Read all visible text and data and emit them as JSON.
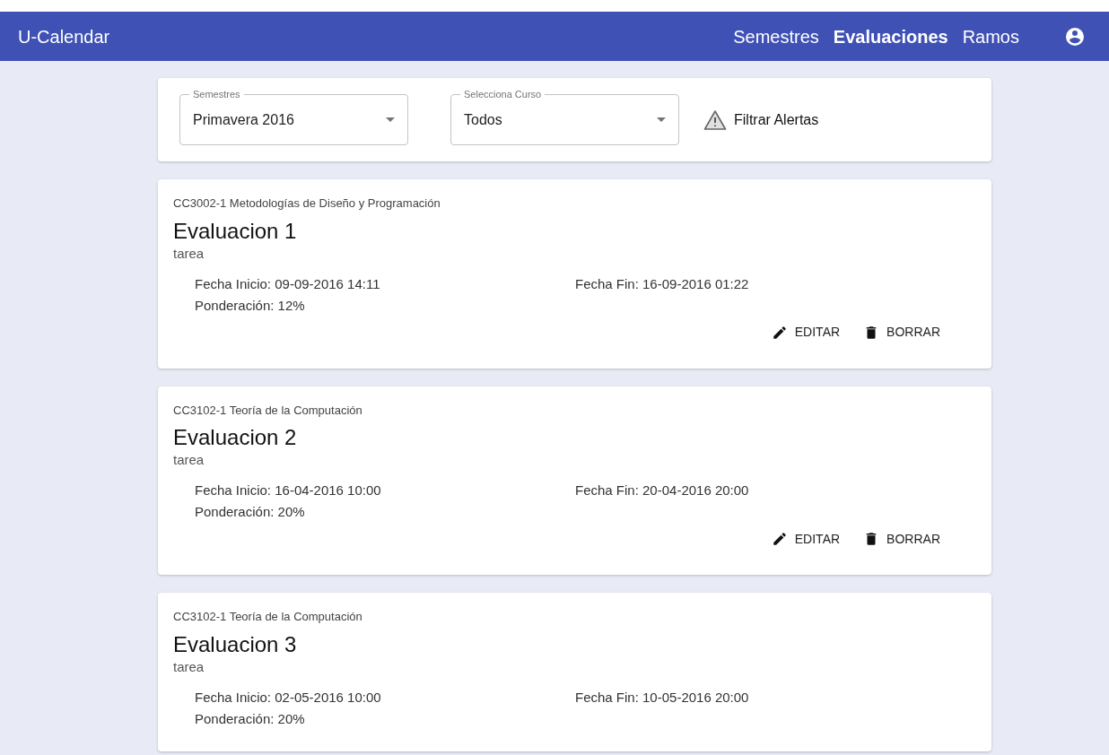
{
  "app_bar": {
    "title": "U-Calendar",
    "nav": [
      {
        "label": "Semestres",
        "selected": false
      },
      {
        "label": "Evaluaciones",
        "selected": true
      },
      {
        "label": "Ramos",
        "selected": false
      }
    ]
  },
  "filters": {
    "semester": {
      "label": "Semestres",
      "value": "Primavera 2016"
    },
    "course": {
      "label": "Selecciona Curso",
      "value": "Todos"
    },
    "alerts_button": "Filtrar Alertas"
  },
  "evaluations": [
    {
      "course": "CC3002-1 Metodologías de Diseño y Programación",
      "title": "Evaluacion 1",
      "type": "tarea",
      "start": "Fecha Inicio: 09-09-2016 14:11",
      "end": "Fecha Fin: 16-09-2016 01:22",
      "weight": "Ponderación: 12%",
      "actions": [
        "EDITAR",
        "BORRAR"
      ]
    },
    {
      "course": "CC3102-1 Teoría de la Computación",
      "title": "Evaluacion 2",
      "type": "tarea",
      "start": "Fecha Inicio: 16-04-2016 10:00",
      "end": "Fecha Fin: 20-04-2016 20:00",
      "weight": "Ponderación: 20%",
      "actions": [
        "EDITAR",
        "BORRAR"
      ]
    },
    {
      "course": "CC3102-1 Teoría de la Computación",
      "title": "Evaluacion 3",
      "type": "tarea",
      "start": "Fecha Inicio: 02-05-2016 10:00",
      "end": "Fecha Fin: 10-05-2016 20:00",
      "weight": "Ponderación: 20%"
    }
  ]
}
